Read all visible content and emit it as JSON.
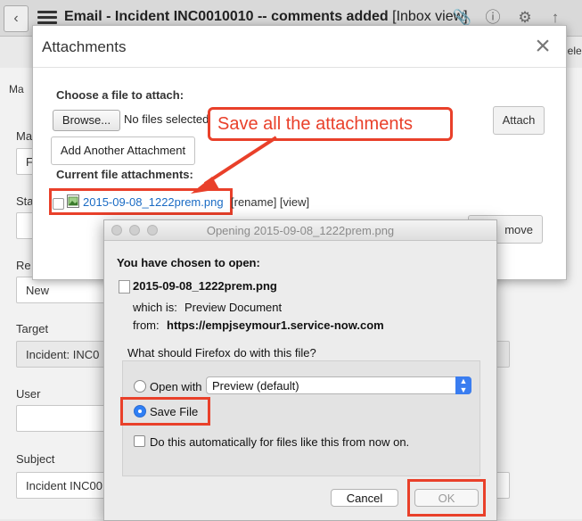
{
  "app": {
    "title": "Email - Incident INC0010010 -- comments added",
    "title_suffix": "[Inbox view]",
    "tab_left": "Ma",
    "tab_right": "Dele"
  },
  "form": {
    "label_ma": "Ma",
    "value_f": "F",
    "label_sta": "Sta",
    "label_re": "Re",
    "value_new": "New",
    "label_target": "Target",
    "value_target": "Incident: INC0",
    "label_user": "User",
    "label_subject": "Subject",
    "value_subject": "Incident INC00"
  },
  "attachments": {
    "title": "Attachments",
    "choose_label": "Choose a file to attach:",
    "browse_label": "Browse...",
    "no_files": "No files selected.",
    "attach_label": "Attach",
    "add_another_label": "Add Another Attachment",
    "current_label": "Current file attachments:",
    "file_name": "2015-09-08_1222prem.png",
    "file_actions": "[rename] [view]",
    "remove_label": "move"
  },
  "callout": {
    "text": "Save all the attachments"
  },
  "firefox_dialog": {
    "title": "Opening 2015-09-08_1222prem.png",
    "chosen_label": "You have chosen to open:",
    "file_name": "2015-09-08_1222prem.png",
    "which_is_label": "which is:",
    "which_is_value": "Preview Document",
    "from_label": "from:",
    "from_value": "https://empjseymour1.service-now.com",
    "question": "What should Firefox do with this file?",
    "open_with_label": "Open with",
    "open_with_value": "Preview (default)",
    "save_file_label": "Save File",
    "auto_label": "Do this automatically for files like this from now on.",
    "cancel_label": "Cancel",
    "ok_label": "OK"
  },
  "colors": {
    "highlight": "#e9402a",
    "link": "#1a6bc4",
    "accent": "#2f7ff5"
  }
}
